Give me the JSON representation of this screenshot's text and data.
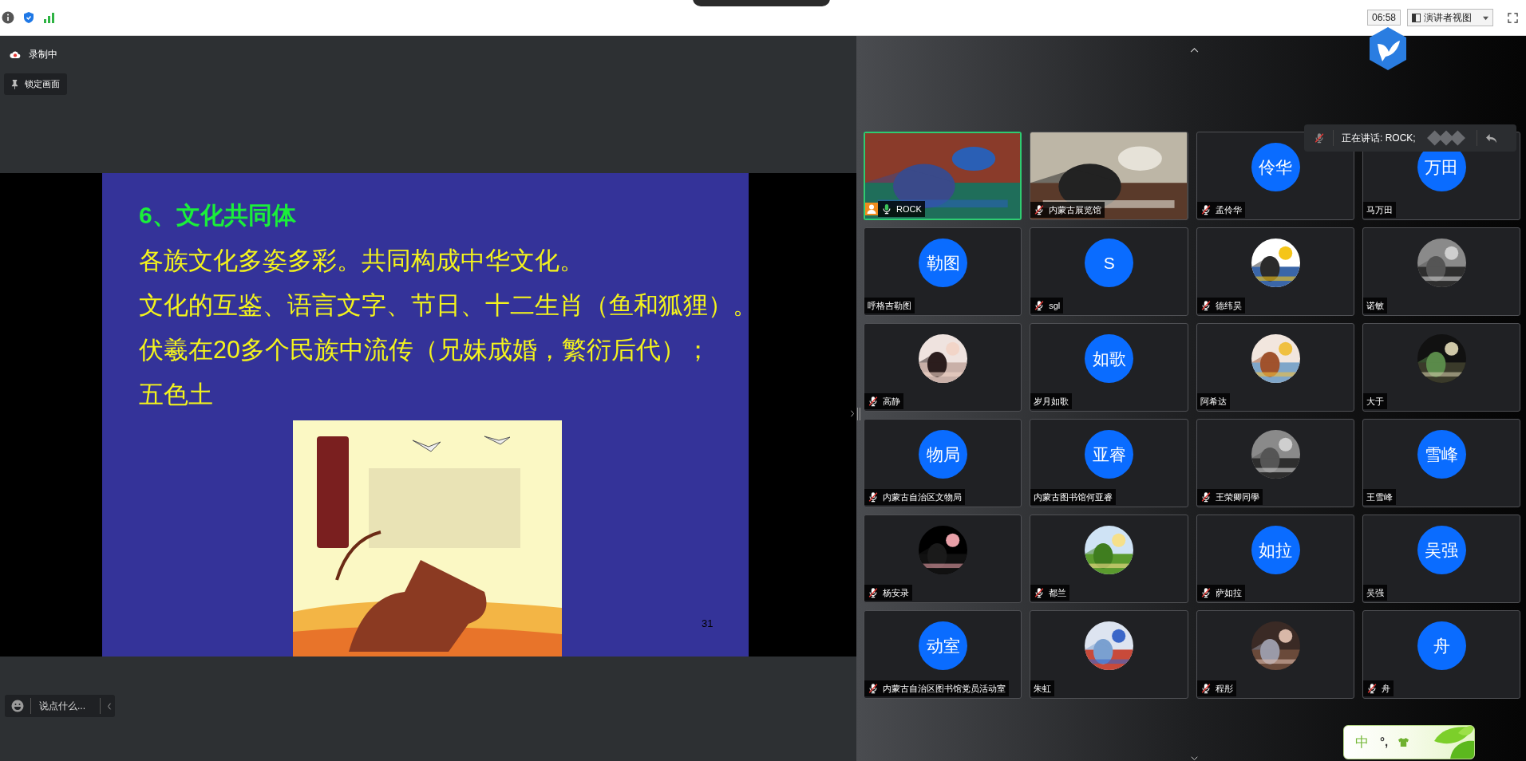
{
  "top_bar": {
    "time": "06:58",
    "view_menu": "演讲者视图"
  },
  "recording": {
    "label": "录制中"
  },
  "lock_button": {
    "label": "锁定画面"
  },
  "slide": {
    "title": "6、文化共同体",
    "lines": [
      "各族文化多姿多彩。共同构成中华文化。",
      "文化的互鉴、语言文字、节日、十二生肖（鱼和狐狸）。",
      "伏羲在20多个民族中流传（兄妹成婚，繁衍后代）；",
      "五色土"
    ],
    "page": "31"
  },
  "chat": {
    "placeholder": "说点什么..."
  },
  "speaking_banner": {
    "label": "正在讲话: ROCK;"
  },
  "participants": [
    {
      "name": "ROCK",
      "kind": "video",
      "muted": false,
      "mic_on": true,
      "host": true,
      "speaking": true
    },
    {
      "name": "内蒙古展览馆",
      "kind": "video",
      "muted": true,
      "mic_on": false,
      "host": false,
      "speaking": false
    },
    {
      "name": "孟伶华",
      "kind": "initials",
      "initials": "伶华",
      "muted": true,
      "mic_on": false,
      "host": false,
      "speaking": false
    },
    {
      "name": "马万田",
      "kind": "initials",
      "initials": "万田",
      "muted": false,
      "mic_on": false,
      "host": false,
      "speaking": false
    },
    {
      "name": "呼格吉勒图",
      "kind": "initials",
      "initials": "勒图",
      "muted": false,
      "mic_on": false,
      "host": false,
      "speaking": false
    },
    {
      "name": "sgl",
      "kind": "initials",
      "initials": "S",
      "muted": true,
      "mic_on": false,
      "host": false,
      "speaking": false
    },
    {
      "name": "德纬昊",
      "kind": "picture",
      "muted": true,
      "mic_on": false,
      "host": false,
      "speaking": false
    },
    {
      "name": "诺敏",
      "kind": "picture",
      "muted": false,
      "mic_on": false,
      "host": false,
      "speaking": false
    },
    {
      "name": "高静",
      "kind": "picture",
      "muted": true,
      "mic_on": false,
      "host": false,
      "speaking": false
    },
    {
      "name": "岁月如歌",
      "kind": "initials",
      "initials": "如歌",
      "muted": false,
      "mic_on": false,
      "host": false,
      "speaking": false
    },
    {
      "name": "阿希达",
      "kind": "picture",
      "muted": false,
      "mic_on": false,
      "host": false,
      "speaking": false
    },
    {
      "name": "大于",
      "kind": "picture",
      "muted": false,
      "mic_on": false,
      "host": false,
      "speaking": false
    },
    {
      "name": "内蒙古自治区文物局",
      "kind": "initials",
      "initials": "物局",
      "muted": true,
      "mic_on": false,
      "host": false,
      "speaking": false
    },
    {
      "name": "内蒙古图书馆何亚睿",
      "kind": "initials",
      "initials": "亚睿",
      "muted": false,
      "mic_on": false,
      "host": false,
      "speaking": false
    },
    {
      "name": "王荣卿同學",
      "kind": "picture",
      "muted": true,
      "mic_on": false,
      "host": false,
      "speaking": false
    },
    {
      "name": "王雪峰",
      "kind": "initials",
      "initials": "雪峰",
      "muted": false,
      "mic_on": false,
      "host": false,
      "speaking": false
    },
    {
      "name": "杨安录",
      "kind": "picture",
      "muted": true,
      "mic_on": false,
      "host": false,
      "speaking": false
    },
    {
      "name": "都兰",
      "kind": "picture",
      "muted": true,
      "mic_on": false,
      "host": false,
      "speaking": false
    },
    {
      "name": "萨如拉",
      "kind": "initials",
      "initials": "如拉",
      "muted": true,
      "mic_on": false,
      "host": false,
      "speaking": false
    },
    {
      "name": "吴强",
      "kind": "initials",
      "initials": "吴强",
      "muted": false,
      "mic_on": false,
      "host": false,
      "speaking": false
    },
    {
      "name": "内蒙古自治区图书馆党员活动室",
      "kind": "initials",
      "initials": "动室",
      "muted": true,
      "mic_on": false,
      "host": false,
      "speaking": false
    },
    {
      "name": "朱虹",
      "kind": "picture",
      "muted": false,
      "mic_on": false,
      "host": false,
      "speaking": false
    },
    {
      "name": "程彤",
      "kind": "picture",
      "muted": true,
      "mic_on": false,
      "host": false,
      "speaking": false
    },
    {
      "name": "舟",
      "kind": "initials",
      "initials": "舟",
      "muted": true,
      "mic_on": false,
      "host": false,
      "speaking": false
    }
  ],
  "ime": {
    "mode": "中",
    "punctuation": "°,"
  }
}
